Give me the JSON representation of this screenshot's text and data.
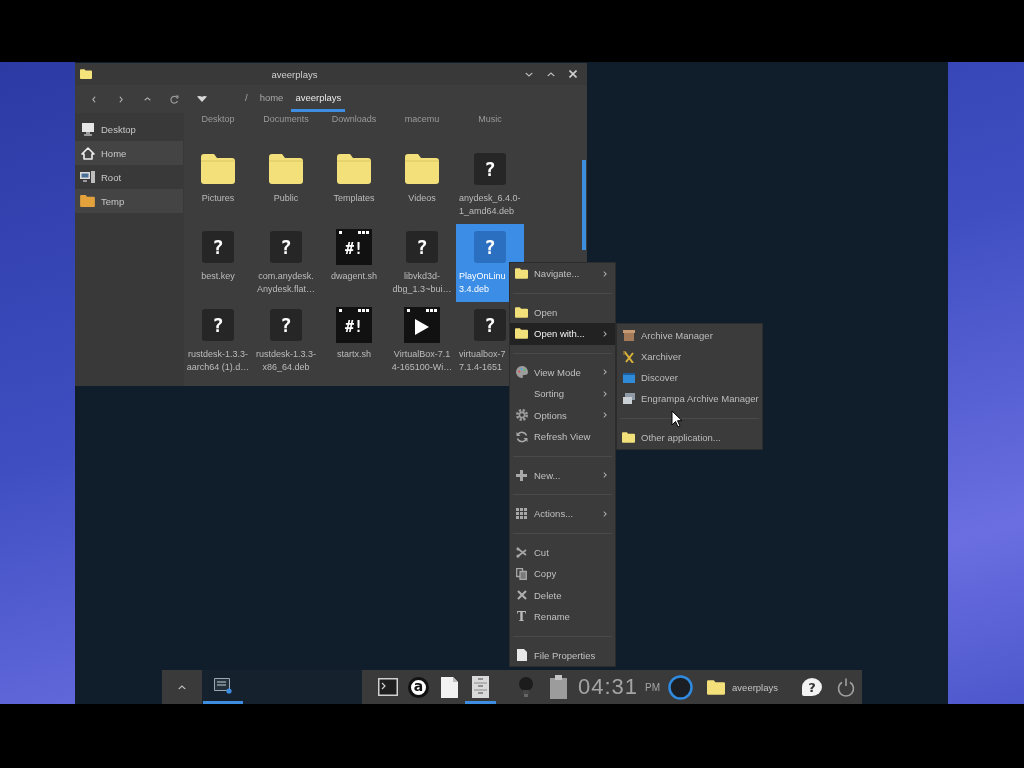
{
  "window": {
    "title": "aveerplays"
  },
  "path": [
    {
      "label": "/",
      "selected": false
    },
    {
      "label": "home",
      "selected": false
    },
    {
      "label": "aveerplays",
      "selected": true
    }
  ],
  "sidebar": {
    "items": [
      {
        "label": "Desktop"
      },
      {
        "label": "Home"
      },
      {
        "label": "Root"
      },
      {
        "label": "Temp"
      }
    ]
  },
  "partly_hidden_row": [
    "Desktop",
    "Documents",
    "Downloads",
    "macemu",
    "Music"
  ],
  "files": [
    {
      "kind": "folder",
      "lines": [
        "Pictures"
      ],
      "selected": false
    },
    {
      "kind": "folder",
      "lines": [
        "Public"
      ],
      "selected": false
    },
    {
      "kind": "folder",
      "lines": [
        "Templates"
      ],
      "selected": false
    },
    {
      "kind": "folder",
      "lines": [
        "Videos"
      ],
      "selected": false
    },
    {
      "kind": "unknown",
      "glyph": "?",
      "lines": [
        "anydesk_6.4.0-",
        "1_amd64.deb"
      ],
      "selected": false
    },
    {
      "kind": "unknown",
      "glyph": "?",
      "lines": [
        "best.key"
      ],
      "selected": false
    },
    {
      "kind": "unknown",
      "glyph": "?",
      "lines": [
        "com.anydesk.",
        "Anydesk.flat…"
      ],
      "selected": false
    },
    {
      "kind": "script",
      "glyph": "#!",
      "lines": [
        "dwagent.sh"
      ],
      "selected": false
    },
    {
      "kind": "unknown",
      "glyph": "?",
      "lines": [
        "libvkd3d-",
        "dbg_1.3~bui…"
      ],
      "selected": false
    },
    {
      "kind": "unknown",
      "glyph": "?",
      "lines": [
        "PlayOnLinu",
        "3.4.deb"
      ],
      "selected": true
    },
    {
      "kind": "unknown",
      "glyph": "?",
      "lines": [
        "rustdesk-1.3.3-",
        "aarch64 (1).d…"
      ],
      "selected": false
    },
    {
      "kind": "unknown",
      "glyph": "?",
      "lines": [
        "rustdesk-1.3.3-",
        "x86_64.deb"
      ],
      "selected": false
    },
    {
      "kind": "script",
      "glyph": "#!",
      "lines": [
        "startx.sh"
      ],
      "selected": false
    },
    {
      "kind": "video",
      "lines": [
        "VirtualBox-7.1",
        "4-165100-Wi…"
      ],
      "selected": false
    },
    {
      "kind": "unknown",
      "glyph": "?",
      "lines": [
        "virtualbox-7",
        "7.1.4-1651"
      ],
      "selected": false
    }
  ],
  "context_menu": {
    "items": [
      {
        "kind": "item",
        "label": "Navigate...",
        "submenu": true,
        "selected": false
      },
      {
        "kind": "separator"
      },
      {
        "kind": "item",
        "label": "Open",
        "submenu": false,
        "selected": false
      },
      {
        "kind": "item",
        "label": "Open with...",
        "submenu": true,
        "selected": true,
        "submenu_items": [
          {
            "kind": "item",
            "label": "Archive Manager"
          },
          {
            "kind": "item",
            "label": "Xarchiver"
          },
          {
            "kind": "item",
            "label": "Discover"
          },
          {
            "kind": "item",
            "label": "Engrampa Archive Manager"
          },
          {
            "kind": "separator"
          },
          {
            "kind": "item",
            "label": "Other application..."
          }
        ]
      },
      {
        "kind": "separator"
      },
      {
        "kind": "item",
        "label": "View Mode",
        "submenu": true,
        "selected": false
      },
      {
        "kind": "item",
        "label": "Sorting",
        "submenu": true,
        "selected": false
      },
      {
        "kind": "item",
        "label": "Options",
        "submenu": true,
        "selected": false
      },
      {
        "kind": "item",
        "label": "Refresh View",
        "submenu": false,
        "selected": false
      },
      {
        "kind": "separator"
      },
      {
        "kind": "item",
        "label": "New...",
        "submenu": true,
        "selected": false
      },
      {
        "kind": "separator"
      },
      {
        "kind": "item",
        "label": "Actions...",
        "submenu": true,
        "selected": false
      },
      {
        "kind": "separator"
      },
      {
        "kind": "item",
        "label": "Cut",
        "submenu": false,
        "selected": false
      },
      {
        "kind": "item",
        "label": "Copy",
        "submenu": false,
        "selected": false
      },
      {
        "kind": "item",
        "label": "Delete",
        "submenu": false,
        "selected": false
      },
      {
        "kind": "item",
        "label": "Rename",
        "glyph": "T",
        "submenu": false,
        "selected": false
      },
      {
        "kind": "separator"
      },
      {
        "kind": "item",
        "label": "File Properties",
        "submenu": false,
        "selected": false
      }
    ]
  },
  "taskbar": {
    "tasks": [
      {
        "selected": true
      }
    ],
    "launchers": [
      {
        "selected": false
      },
      {
        "glyph": "a",
        "selected": false
      },
      {
        "selected": false
      },
      {
        "selected": true
      }
    ],
    "clock": {
      "time": "04:31",
      "period": "PM"
    },
    "places_label": "aveerplays",
    "help_glyph": "?"
  }
}
